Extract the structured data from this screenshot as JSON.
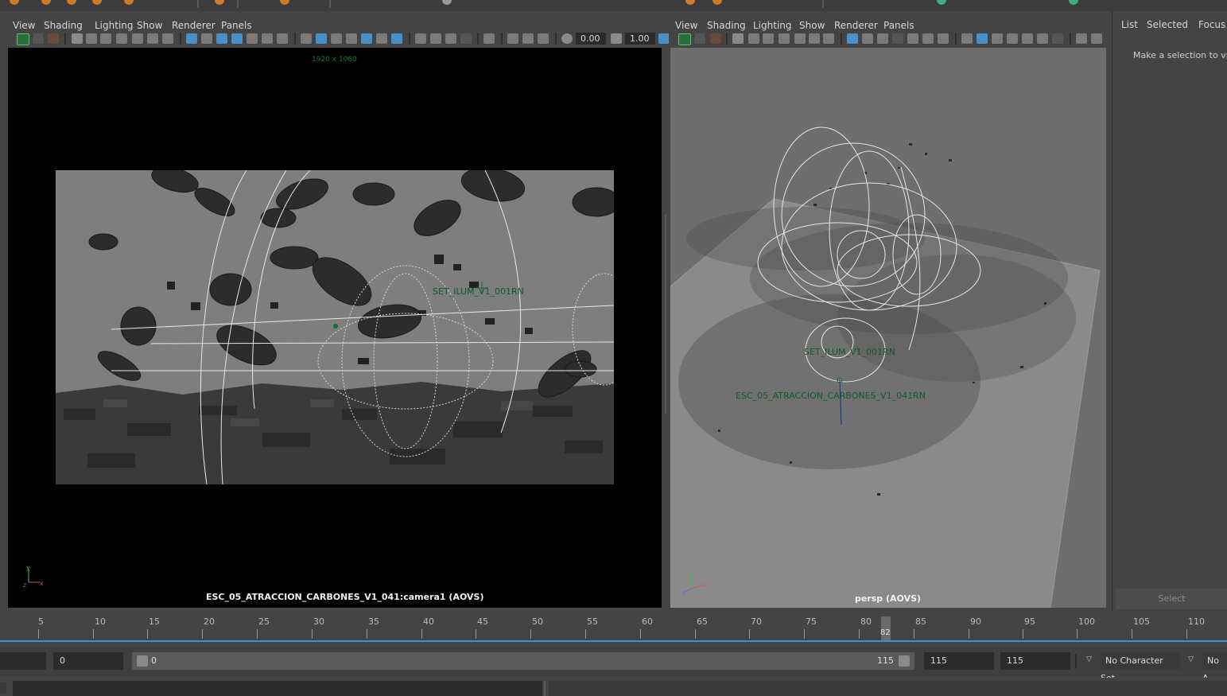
{
  "viewport_left": {
    "menu": [
      "View",
      "Shading",
      "Lighting",
      "Show",
      "Renderer",
      "Panels"
    ],
    "exposure": "0.00",
    "gamma": "1.00",
    "resolution": "1920 x 1080",
    "camera_label": "ESC_05_ATRACCION_CARBONES_V1_041:camera1 (AOVS)",
    "node_label": "SET_ILUM_V1_001RN"
  },
  "viewport_right": {
    "menu": [
      "View",
      "Shading",
      "Lighting",
      "Show",
      "Renderer",
      "Panels"
    ],
    "camera_label": "persp (AOVS)",
    "node_label_1": "SET_ILUM_V1_001RN",
    "node_label_2": "ESC_05_ATRACCION_CARBONES_V1_041RN"
  },
  "outliner": {
    "menu": [
      "List",
      "Selected",
      "Focus"
    ],
    "message": "Make a selection to view",
    "select_button": "Select"
  },
  "timeslider": {
    "ticks": [
      "5",
      "10",
      "15",
      "20",
      "25",
      "30",
      "35",
      "40",
      "45",
      "50",
      "55",
      "60",
      "65",
      "70",
      "75",
      "80",
      "85",
      "90",
      "95",
      "100",
      "105",
      "110"
    ],
    "current_frame": "82"
  },
  "range": {
    "start_field": "0",
    "range_start": "0",
    "range_end": "115",
    "end_field_1": "115",
    "end_field_2": "115",
    "character_set": "No Character Set",
    "anim_layer": "No A"
  },
  "colors": {
    "accent_blue": "#4a90c8",
    "label_green": "#0f5a2a",
    "viewport_bg_gray": "#7d7d7d"
  }
}
